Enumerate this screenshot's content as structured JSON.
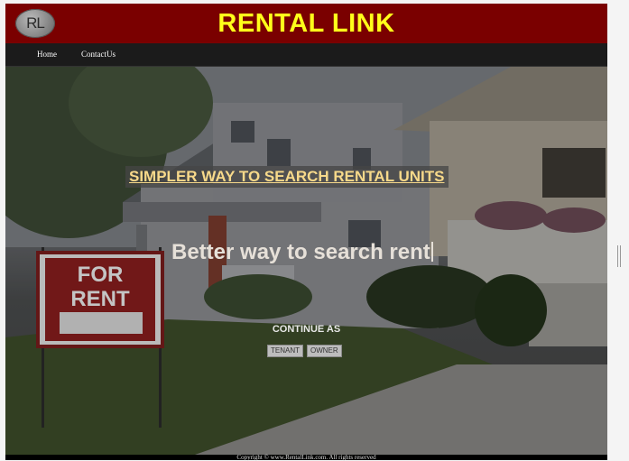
{
  "header": {
    "logo_text": "RL",
    "title": "RENTAL LINK"
  },
  "nav": {
    "home": "Home",
    "contact": "ContactUs"
  },
  "hero": {
    "title": "SIMPLER WAY TO SEARCH RENTAL UNITS",
    "typing_text": "Better way to search rent",
    "continue_label": "CONTINUE AS",
    "tenant_button": "TENANT",
    "owner_button": "OWNER",
    "sign_text_line1": "FOR",
    "sign_text_line2": "RENT"
  },
  "footer": {
    "copyright": "Copyright © www.RentalLink.com. All rights reserved"
  },
  "colors": {
    "header_bg": "#7a0000",
    "title_yellow": "#ffff1a",
    "hero_title": "#f7d98a"
  }
}
